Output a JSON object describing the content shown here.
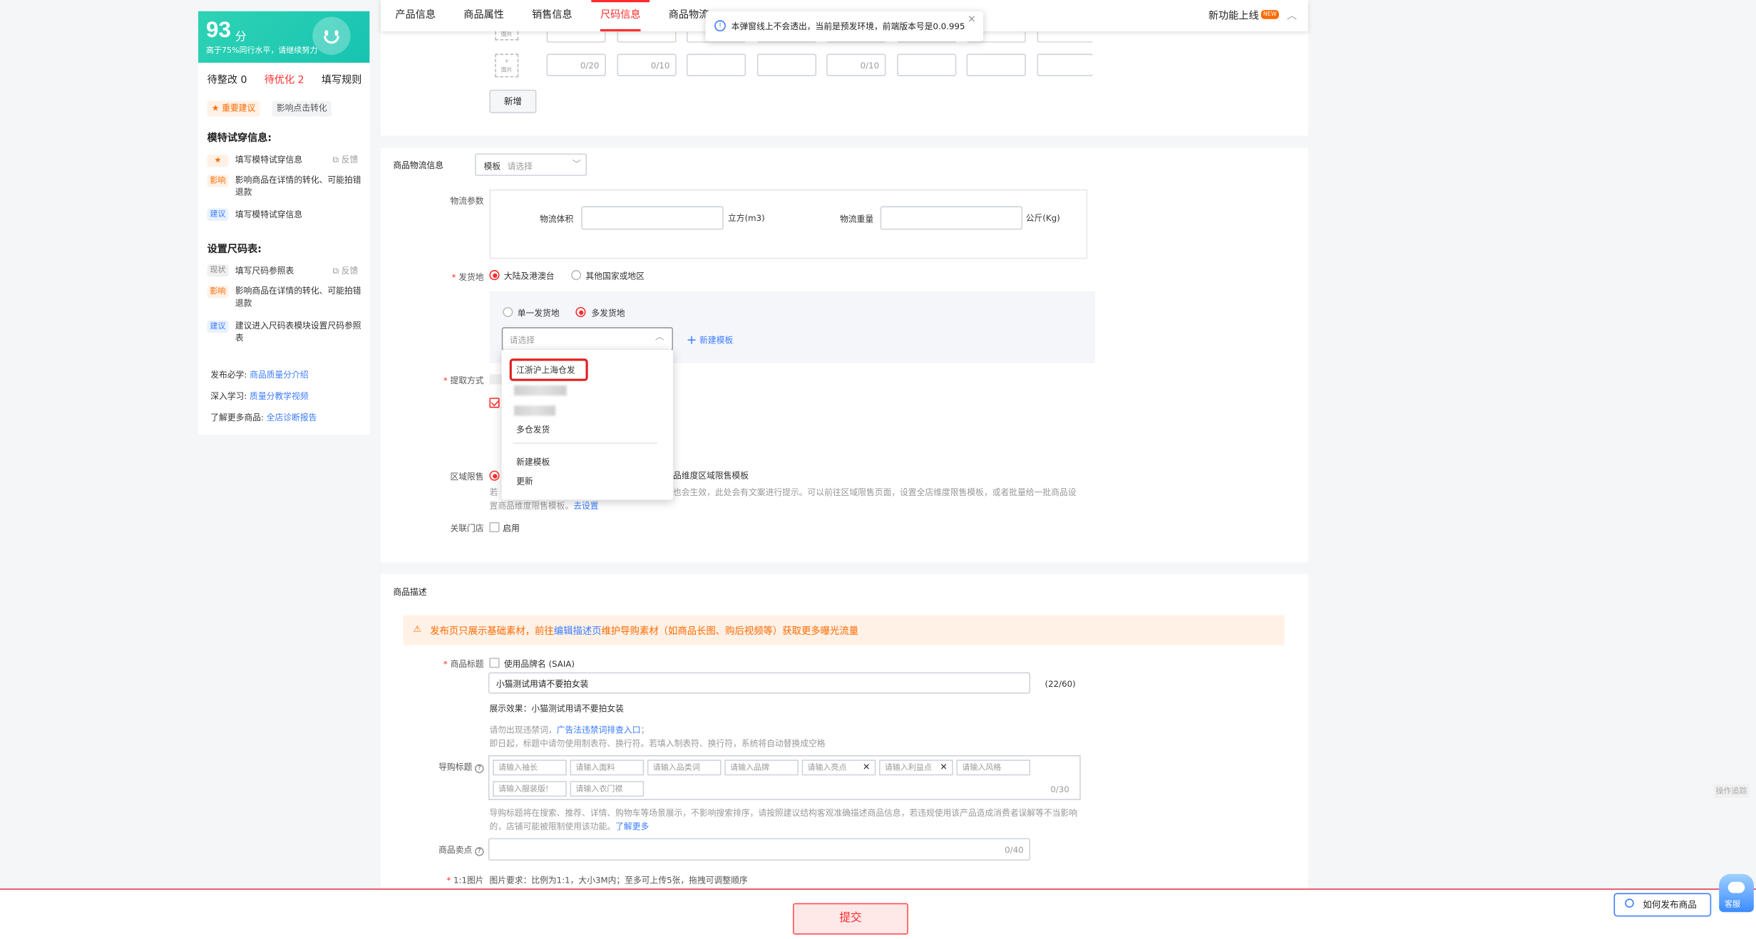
{
  "score": {
    "value": "93",
    "unit": "分",
    "subtitle": "高于75%同行水平，请继续努力",
    "tabs": [
      {
        "label": "待整改 0"
      },
      {
        "label": "待优化 2"
      },
      {
        "label": "填写规则"
      }
    ],
    "filters": [
      {
        "label": "★ 重要建议"
      },
      {
        "label": "影响点击转化"
      }
    ],
    "sections": [
      {
        "title": "模特试穿信息:",
        "items": [
          {
            "badge": "★",
            "text": "填写模特试穿信息",
            "feedback": "反馈"
          },
          {
            "badge": "影响",
            "text": "影响商品在详情的转化、可能拍错退款"
          },
          {
            "badge": "建议",
            "text": "填写模特试穿信息"
          }
        ]
      },
      {
        "title": "设置尺码表:",
        "items": [
          {
            "badge": "现状",
            "text": "填写尺码参照表",
            "feedback": "反馈"
          },
          {
            "badge": "影响",
            "text": "影响商品在详情的转化、可能拍错退款"
          },
          {
            "badge": "建议",
            "text": "建议进入尺码表模块设置尺码参照表"
          }
        ]
      }
    ],
    "footer": [
      {
        "prefix": "发布必学:",
        "link": "商品质量分介绍"
      },
      {
        "prefix": "深入学习:",
        "link": "质量分教学视频"
      },
      {
        "prefix": "了解更多商品:",
        "link": "全店诊断报告"
      }
    ]
  },
  "nav": {
    "tabs": [
      "产品信息",
      "商品属性",
      "销售信息",
      "尺码信息",
      "商品物流"
    ],
    "active_tab": "尺码信息",
    "new_feature": "新功能上线",
    "new_badge": "NEW"
  },
  "toast": {
    "text": "本弹窗线上不会透出，当前是预发环境，前端版本号是0.0.995"
  },
  "sku_table": {
    "image_label": "图片",
    "add_label": "+",
    "cells": [
      "0/20",
      "0/10",
      "",
      "",
      "0/10",
      "",
      "",
      ""
    ],
    "add_button": "新增"
  },
  "logistics": {
    "section_label": "商品物流信息",
    "template_prefix": "模板",
    "template_placeholder": "请选择",
    "params_label": "物流参数",
    "volume_label": "物流体积",
    "volume_unit": "立方(m3)",
    "weight_label": "物流重量",
    "weight_unit": "公斤(Kg)",
    "origin_label": "发货地",
    "origin_options": [
      "大陆及港澳台",
      "其他国家或地区"
    ],
    "ship_options": [
      "单一发货地",
      "多发货地"
    ],
    "select_placeholder": "请选择",
    "new_template": "新建模板",
    "pickup_label": "提取方式",
    "region_label": "区域限售",
    "region_text_right": "品维度区域限售模板",
    "region_desc": "若勾选，则此商品也会生效，此处会有文案进行提示。可以前往区域限售页面，设置全店维度限售模板，或者批量给一批商品设置商品维度限售模板。",
    "region_desc_prefix": "若",
    "region_desc_line1": "也会生效，此处会有文案进行提示。可以前往区域限售页面，设置全店维度限售模板，或者批量给一批商品设",
    "region_desc_line2": "置商品维度限售模板。",
    "region_link": "去设置",
    "store_label": "关联门店",
    "store_check": "启用"
  },
  "dropdown": {
    "options": [
      "江浙沪上海仓发",
      "多仓发货",
      "新建模板",
      "更新"
    ]
  },
  "description": {
    "section_label": "商品描述",
    "warn_prefix": "发布页只展示基础素材，前往",
    "warn_link": "编辑描述页",
    "warn_suffix": "维护导购素材（如商品长图、购后视频等）获取更多曝光流量",
    "title_label": "商品标题",
    "brand_check": "使用品牌名 (SAIA)",
    "title_value": "小猫测试用请不要拍女装",
    "title_count": "(22/60)",
    "preview": "展示效果：小猫测试用请不要拍女装",
    "hint1_prefix": "请勿出现违禁词，",
    "hint1_link": "广告法违禁词排查入口",
    "hint1_suffix": "；",
    "hint2": "即日起，标题中请勿使用制表符、换行符。若填入制表符、换行符，系统将自动替换成空格",
    "guide_label": "导购标题",
    "guide_tags": [
      "请输入袖长",
      "请输入面料",
      "请输入品类词",
      "请输入品牌",
      "请输入亮点",
      "请输入利益点",
      "请输入风格",
      "请输入服装版!",
      "请输入衣门襟"
    ],
    "guide_count": "0/30",
    "guide_desc1": "导购标题将在搜索、推荐、详情、购物车等场景展示，不影响搜索排序，请按照建议结构客观准确描述商品信息，若违规使用该产品造成消费者误解等不当影响",
    "guide_desc2": "的，店铺可能被限制使用该功能。",
    "guide_more": "了解更多",
    "selling_label": "商品卖点",
    "selling_count": "0/40",
    "img_label": "1:1图片",
    "img_hint": "图片要求：比例为1:1，大小3M内；至多可上传5张，拖拽可调整顺序"
  },
  "footer": {
    "submit": "提交",
    "howto": "如何发布商品",
    "service": "客服",
    "trace": "操作追踪"
  }
}
